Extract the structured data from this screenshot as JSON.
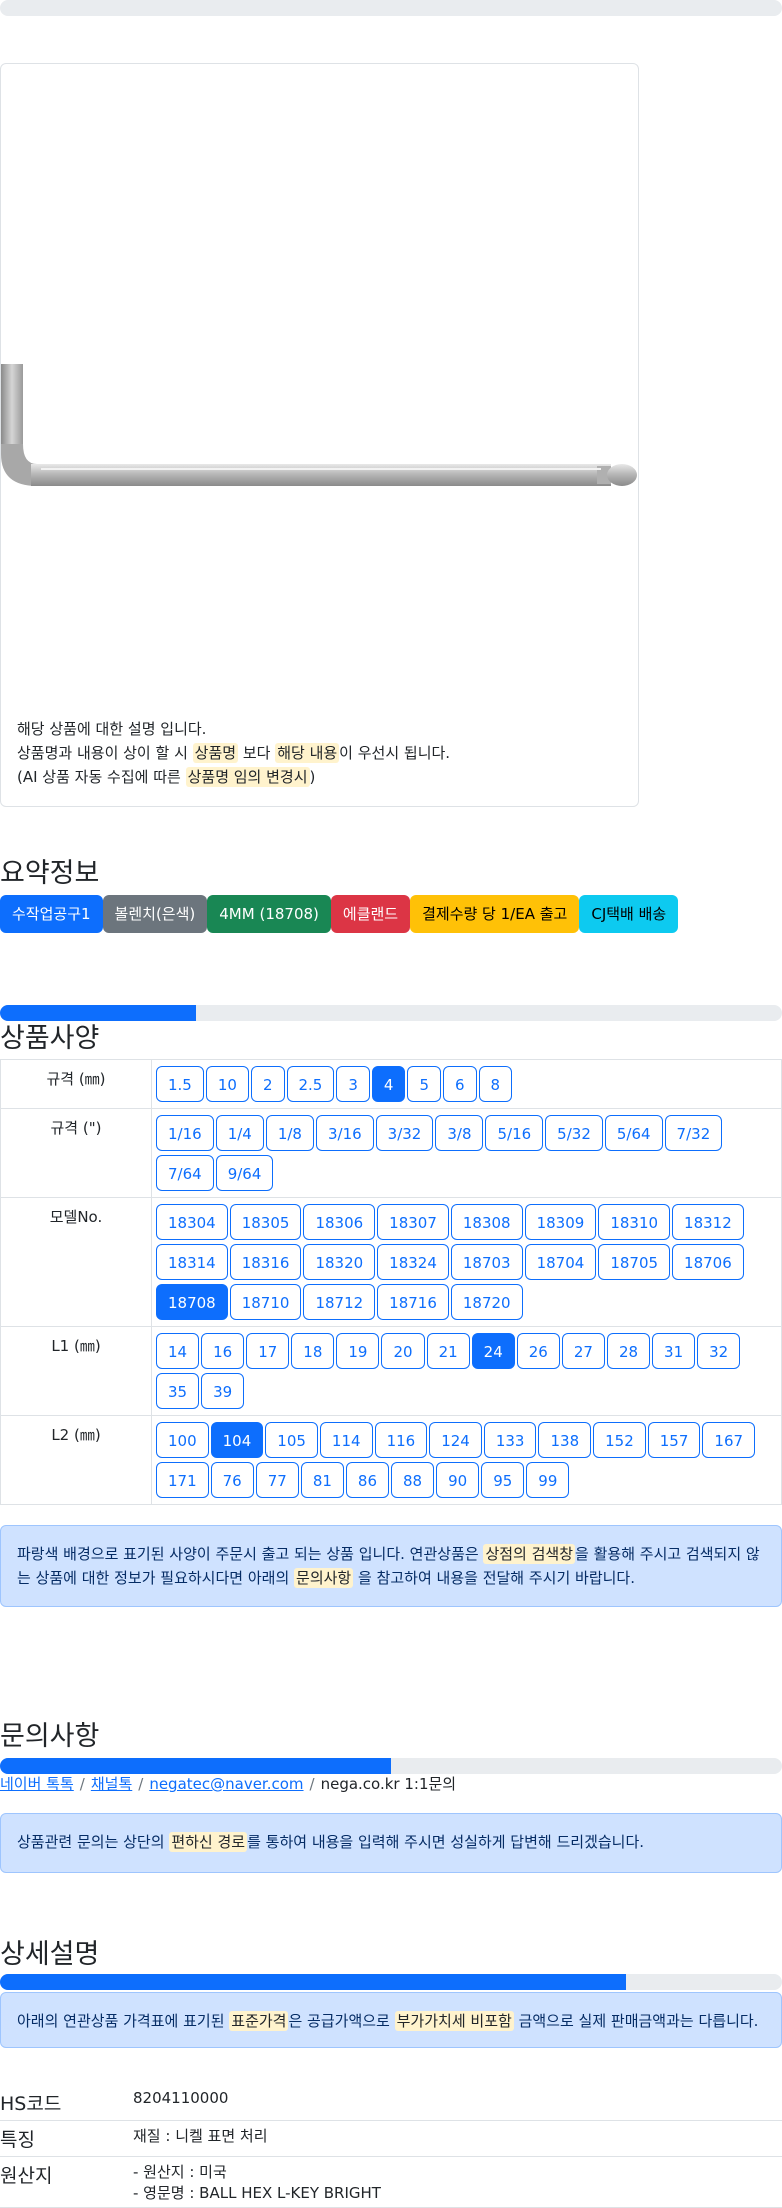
{
  "product_image": {
    "notice_line1": "해당 상품에 대한 설명 입니다.",
    "notice_line2_a": "상품명과 내용이 상이 할 시 ",
    "notice_line2_b": "상품명",
    "notice_line2_c": " 보다 ",
    "notice_line2_d": "해당 내용",
    "notice_line2_e": "이 우선시 됩니다.",
    "notice_line3_a": "(AI 상품 자동 수집에 따른 ",
    "notice_line3_b": "상품명 임의 변경시",
    "notice_line3_c": ")"
  },
  "summary": {
    "title": "요약정보",
    "badges": [
      {
        "label": "수작업공구1",
        "color": "#0d6efd"
      },
      {
        "label": "볼렌치(은색)",
        "color": "#6c757d"
      },
      {
        "label": "4MM (18708)",
        "color": "#198754"
      },
      {
        "label": "에클랜드",
        "color": "#dc3545"
      },
      {
        "label": "결제수량 당 1/EA 출고",
        "color": "#ffc107"
      },
      {
        "label": "CJ택배 배송",
        "color": "#0dcaf0"
      }
    ]
  },
  "spec": {
    "progress_fraction": 0.25,
    "title": "상품사양",
    "rows": [
      {
        "label": "규격 (㎜)",
        "options": [
          "1.5",
          "10",
          "2",
          "2.5",
          "3",
          "4",
          "5",
          "6",
          "8"
        ],
        "selected": "4"
      },
      {
        "label": "규격 (\")",
        "options": [
          "1/16",
          "1/4",
          "1/8",
          "3/16",
          "3/32",
          "3/8",
          "5/16",
          "5/32",
          "5/64",
          "7/32",
          "7/64",
          "9/64"
        ],
        "selected": ""
      },
      {
        "label": "모델No.",
        "options": [
          "18304",
          "18305",
          "18306",
          "18307",
          "18308",
          "18309",
          "18310",
          "18312",
          "18314",
          "18316",
          "18320",
          "18324",
          "18703",
          "18704",
          "18705",
          "18706",
          "18708",
          "18710",
          "18712",
          "18716",
          "18720"
        ],
        "selected": "18708"
      },
      {
        "label": "L1 (㎜)",
        "options": [
          "14",
          "16",
          "17",
          "18",
          "19",
          "20",
          "21",
          "24",
          "26",
          "27",
          "28",
          "31",
          "32",
          "35",
          "39"
        ],
        "selected": "24"
      },
      {
        "label": "L2 (㎜)",
        "options": [
          "100",
          "104",
          "105",
          "114",
          "116",
          "124",
          "133",
          "138",
          "152",
          "157",
          "167",
          "171",
          "76",
          "77",
          "81",
          "86",
          "88",
          "90",
          "95",
          "99"
        ],
        "selected": "104"
      }
    ],
    "alert_a": "파랑색 배경으로 표기된 사양이 주문시 출고 되는 상품 입니다. 연관상품은 ",
    "alert_b": "상점의 검색창",
    "alert_c": "을 활용해 주시고 검색되지 않는 상품에 대한 정보가 필요하시다면 아래의 ",
    "alert_d": "문의사항",
    "alert_e": " 을 참고하여 내용을 전달해 주시기 바랍니다."
  },
  "inquiry": {
    "title": "문의사항",
    "progress_fraction": 0.5,
    "links": [
      "네이버 톡톡",
      "채널톡",
      "negatec@naver.com"
    ],
    "plain": "nega.co.kr 1:1문의",
    "alert_a": "상품관련 문의는 상단의 ",
    "alert_b": "편하신 경로",
    "alert_c": "를 통하여 내용을 입력해 주시면 성실하게 답변해 드리겠습니다."
  },
  "detail": {
    "title": "상세설명",
    "progress_fraction": 0.8,
    "alert_a": "아래의 연관상품 가격표에 표기된 ",
    "alert_b": "표준가격",
    "alert_c": "은 공급가액으로 ",
    "alert_d": "부가가치세 비포함",
    "alert_e": " 금액으로 실제 판매금액과는 다릅니다."
  },
  "info": {
    "hs_label": "HS코드",
    "hs_value": "8204110000",
    "feature_label": "특징",
    "feature_value": "재질 : 니켈 표면 처리",
    "origin_label": "원산지",
    "origin_value1": "- 원산지 : 미국",
    "origin_value2": "- 영문명 : BALL HEX L-KEY BRIGHT"
  }
}
